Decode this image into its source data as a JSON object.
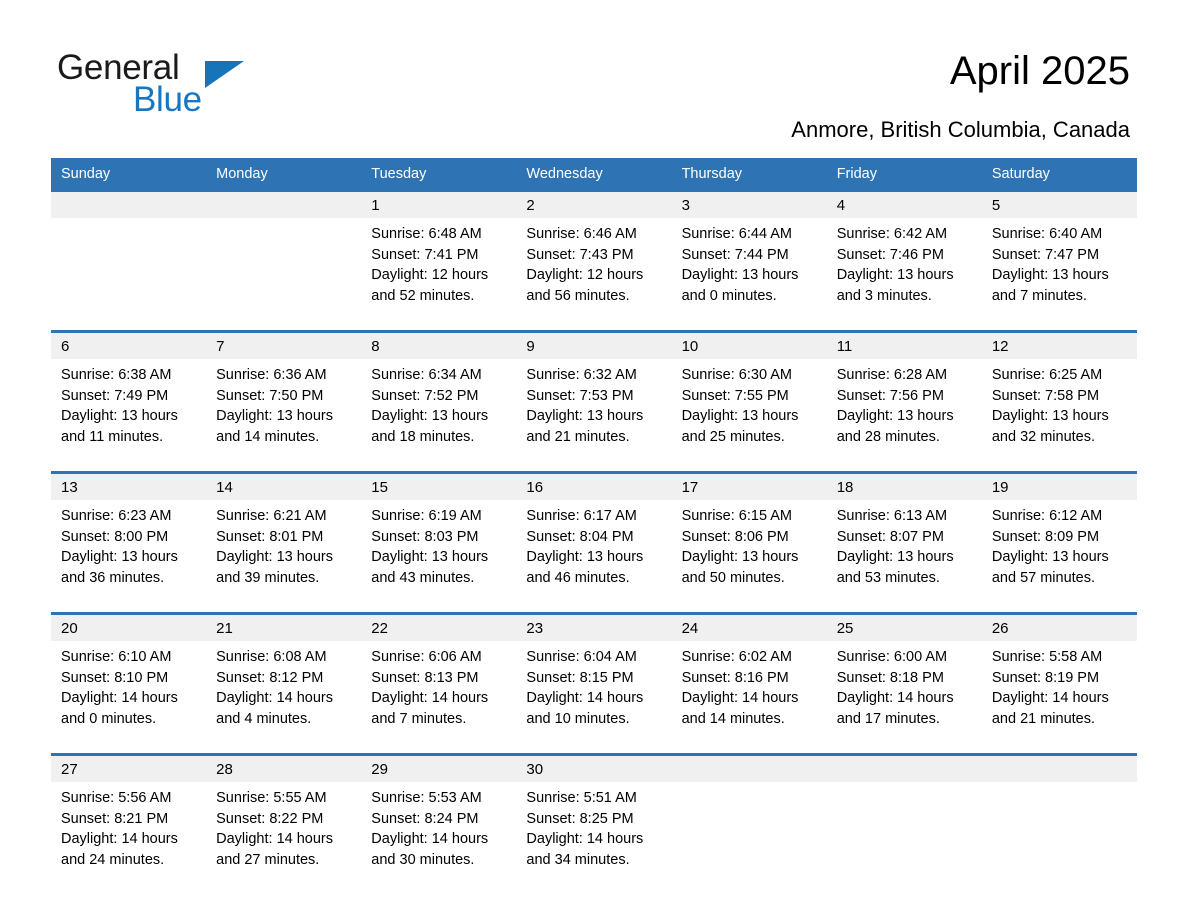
{
  "brand": {
    "name_part1": "General",
    "name_part2": "Blue",
    "triangle_color": "#1874b8",
    "blue_color": "#1577c4"
  },
  "header": {
    "title": "April 2025",
    "subtitle": "Anmore, British Columbia, Canada"
  },
  "theme": {
    "header_blue": "#2e74b5",
    "daynum_strip": "#f0f0f0",
    "text": "#000000"
  },
  "calendar": {
    "weekdays": [
      "Sunday",
      "Monday",
      "Tuesday",
      "Wednesday",
      "Thursday",
      "Friday",
      "Saturday"
    ],
    "weeks": [
      [
        {
          "day": "",
          "detail": ""
        },
        {
          "day": "",
          "detail": ""
        },
        {
          "day": "1",
          "detail": "Sunrise: 6:48 AM\nSunset: 7:41 PM\nDaylight: 12 hours and 52 minutes."
        },
        {
          "day": "2",
          "detail": "Sunrise: 6:46 AM\nSunset: 7:43 PM\nDaylight: 12 hours and 56 minutes."
        },
        {
          "day": "3",
          "detail": "Sunrise: 6:44 AM\nSunset: 7:44 PM\nDaylight: 13 hours and 0 minutes."
        },
        {
          "day": "4",
          "detail": "Sunrise: 6:42 AM\nSunset: 7:46 PM\nDaylight: 13 hours and 3 minutes."
        },
        {
          "day": "5",
          "detail": "Sunrise: 6:40 AM\nSunset: 7:47 PM\nDaylight: 13 hours and 7 minutes."
        }
      ],
      [
        {
          "day": "6",
          "detail": "Sunrise: 6:38 AM\nSunset: 7:49 PM\nDaylight: 13 hours and 11 minutes."
        },
        {
          "day": "7",
          "detail": "Sunrise: 6:36 AM\nSunset: 7:50 PM\nDaylight: 13 hours and 14 minutes."
        },
        {
          "day": "8",
          "detail": "Sunrise: 6:34 AM\nSunset: 7:52 PM\nDaylight: 13 hours and 18 minutes."
        },
        {
          "day": "9",
          "detail": "Sunrise: 6:32 AM\nSunset: 7:53 PM\nDaylight: 13 hours and 21 minutes."
        },
        {
          "day": "10",
          "detail": "Sunrise: 6:30 AM\nSunset: 7:55 PM\nDaylight: 13 hours and 25 minutes."
        },
        {
          "day": "11",
          "detail": "Sunrise: 6:28 AM\nSunset: 7:56 PM\nDaylight: 13 hours and 28 minutes."
        },
        {
          "day": "12",
          "detail": "Sunrise: 6:25 AM\nSunset: 7:58 PM\nDaylight: 13 hours and 32 minutes."
        }
      ],
      [
        {
          "day": "13",
          "detail": "Sunrise: 6:23 AM\nSunset: 8:00 PM\nDaylight: 13 hours and 36 minutes."
        },
        {
          "day": "14",
          "detail": "Sunrise: 6:21 AM\nSunset: 8:01 PM\nDaylight: 13 hours and 39 minutes."
        },
        {
          "day": "15",
          "detail": "Sunrise: 6:19 AM\nSunset: 8:03 PM\nDaylight: 13 hours and 43 minutes."
        },
        {
          "day": "16",
          "detail": "Sunrise: 6:17 AM\nSunset: 8:04 PM\nDaylight: 13 hours and 46 minutes."
        },
        {
          "day": "17",
          "detail": "Sunrise: 6:15 AM\nSunset: 8:06 PM\nDaylight: 13 hours and 50 minutes."
        },
        {
          "day": "18",
          "detail": "Sunrise: 6:13 AM\nSunset: 8:07 PM\nDaylight: 13 hours and 53 minutes."
        },
        {
          "day": "19",
          "detail": "Sunrise: 6:12 AM\nSunset: 8:09 PM\nDaylight: 13 hours and 57 minutes."
        }
      ],
      [
        {
          "day": "20",
          "detail": "Sunrise: 6:10 AM\nSunset: 8:10 PM\nDaylight: 14 hours and 0 minutes."
        },
        {
          "day": "21",
          "detail": "Sunrise: 6:08 AM\nSunset: 8:12 PM\nDaylight: 14 hours and 4 minutes."
        },
        {
          "day": "22",
          "detail": "Sunrise: 6:06 AM\nSunset: 8:13 PM\nDaylight: 14 hours and 7 minutes."
        },
        {
          "day": "23",
          "detail": "Sunrise: 6:04 AM\nSunset: 8:15 PM\nDaylight: 14 hours and 10 minutes."
        },
        {
          "day": "24",
          "detail": "Sunrise: 6:02 AM\nSunset: 8:16 PM\nDaylight: 14 hours and 14 minutes."
        },
        {
          "day": "25",
          "detail": "Sunrise: 6:00 AM\nSunset: 8:18 PM\nDaylight: 14 hours and 17 minutes."
        },
        {
          "day": "26",
          "detail": "Sunrise: 5:58 AM\nSunset: 8:19 PM\nDaylight: 14 hours and 21 minutes."
        }
      ],
      [
        {
          "day": "27",
          "detail": "Sunrise: 5:56 AM\nSunset: 8:21 PM\nDaylight: 14 hours and 24 minutes."
        },
        {
          "day": "28",
          "detail": "Sunrise: 5:55 AM\nSunset: 8:22 PM\nDaylight: 14 hours and 27 minutes."
        },
        {
          "day": "29",
          "detail": "Sunrise: 5:53 AM\nSunset: 8:24 PM\nDaylight: 14 hours and 30 minutes."
        },
        {
          "day": "30",
          "detail": "Sunrise: 5:51 AM\nSunset: 8:25 PM\nDaylight: 14 hours and 34 minutes."
        },
        {
          "day": "",
          "detail": ""
        },
        {
          "day": "",
          "detail": ""
        },
        {
          "day": "",
          "detail": ""
        }
      ]
    ]
  }
}
